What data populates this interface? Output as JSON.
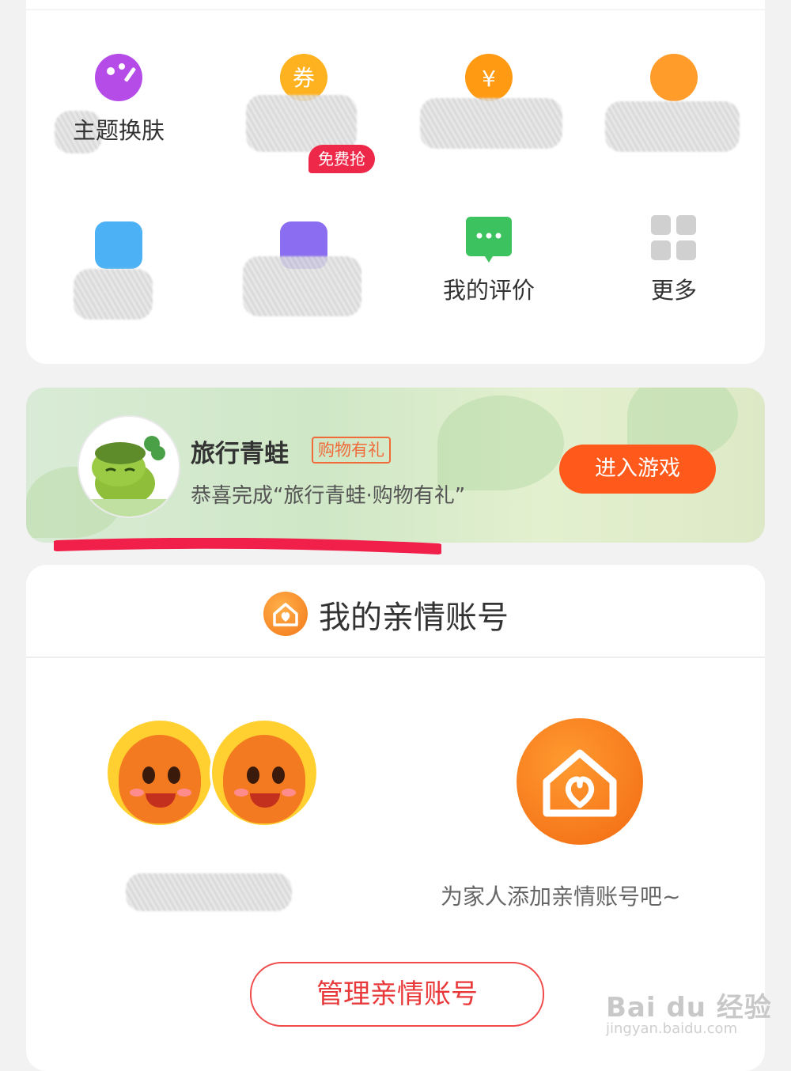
{
  "tools": {
    "row1": [
      {
        "label": "主题换肤",
        "icon": "palette-icon",
        "color": "#b54ce8"
      },
      {
        "label": "",
        "icon": "coupon-icon",
        "color": "#ffb21f"
      },
      {
        "label": "",
        "icon": "coin-exchange-icon",
        "color": "#ff9a12"
      },
      {
        "label": "",
        "icon": "assistant-icon",
        "color": "#ff9c2a"
      }
    ],
    "row2": [
      {
        "label": "",
        "icon": "blue-icon",
        "color": "#4db2f5"
      },
      {
        "label": "",
        "icon": "card-icon",
        "color": "#8a6df0",
        "badge": "免费抢"
      },
      {
        "label": "我的评价",
        "icon": "message-icon",
        "color": "#3cc35f"
      },
      {
        "label": "更多",
        "icon": "grid-icon",
        "color": "#cccccc"
      }
    ]
  },
  "banner": {
    "title": "旅行青蛙",
    "tag": "购物有礼",
    "desc": "恭喜完成“旅行青蛙·购物有礼”",
    "button": "进入游戏"
  },
  "family": {
    "title": "我的亲情账号",
    "left_label": "",
    "right_label": "为家人添加亲情账号吧~",
    "manage_button": "管理亲情账号"
  },
  "watermark": {
    "text": "Bai du 经验",
    "sub": "jingyan.baidu.com"
  }
}
